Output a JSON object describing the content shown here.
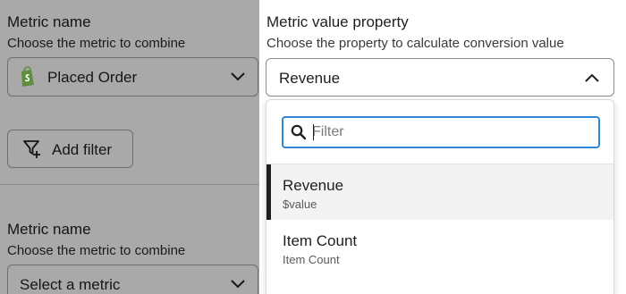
{
  "left": {
    "block1": {
      "title": "Metric name",
      "subtitle": "Choose the metric to combine",
      "selected_metric": "Placed Order",
      "metric_icon": "shopify-icon"
    },
    "add_filter_label": "Add filter",
    "block2": {
      "title": "Metric name",
      "subtitle": "Choose the metric to combine",
      "placeholder": "Select a metric"
    }
  },
  "right": {
    "title": "Metric value property",
    "subtitle": "Choose the property to calculate conversion value",
    "selected_value": "Revenue",
    "search": {
      "placeholder": "Filter",
      "value": ""
    },
    "options": [
      {
        "label": "Revenue",
        "sublabel": "$value",
        "selected": true
      },
      {
        "label": "Item Count",
        "sublabel": "Item Count",
        "selected": false
      }
    ]
  },
  "colors": {
    "overlay": "#a9a9a9",
    "focus_border": "#2f88d6",
    "shopify_green": "#95bf47",
    "selected_bar": "#1f1f1f"
  }
}
